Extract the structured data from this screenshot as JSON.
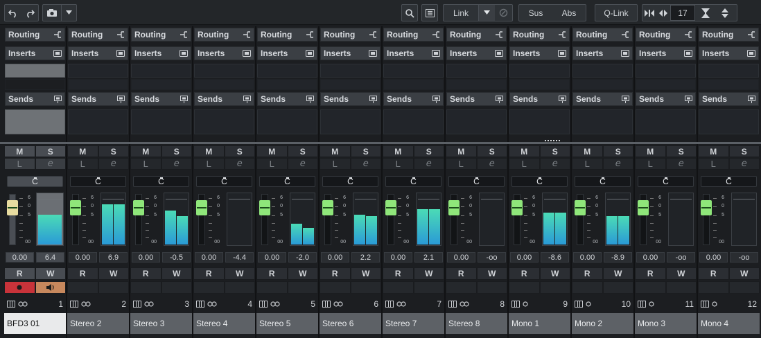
{
  "toolbar": {
    "link_label": "Link",
    "sus_label": "Sus",
    "abs_label": "Abs",
    "qlink_label": "Q-Link",
    "visible_channels": "17"
  },
  "sections": {
    "routing": "Routing",
    "inserts": "Inserts",
    "sends": "Sends"
  },
  "buttons": {
    "mute": "M",
    "solo": "S",
    "listen": "L",
    "edit": "e",
    "read": "R",
    "write": "W"
  },
  "scale_labels": [
    "6",
    "0",
    "5",
    "00"
  ],
  "colors": {
    "meter_top": "#4bdbb6",
    "meter_bottom": "#2a9ad6",
    "record": "#c8333a",
    "monitor": "#c7885d",
    "fader_cap": "#8fe67a",
    "fader_cap_first": "#e8dca0"
  },
  "channels": [
    {
      "number": "1",
      "name": "BFD3 01",
      "volume": "0.00",
      "peak": "6.4",
      "pan": "C",
      "link_icon": "stereo-link-icon",
      "meter": [
        0.58,
        0.58
      ]
    },
    {
      "number": "2",
      "name": "Stereo 2",
      "volume": "0.00",
      "peak": "6.9",
      "pan": "C",
      "link_icon": "stereo-link-icon",
      "meter": [
        0.78,
        0.78
      ]
    },
    {
      "number": "3",
      "name": "Stereo 3",
      "volume": "0.00",
      "peak": "-0.5",
      "pan": "C",
      "link_icon": "stereo-link-icon",
      "meter": [
        0.66,
        0.55
      ]
    },
    {
      "number": "4",
      "name": "Stereo 4",
      "volume": "0.00",
      "peak": "-4.4",
      "pan": "C",
      "link_icon": "stereo-link-icon",
      "meter": [
        0,
        0
      ]
    },
    {
      "number": "5",
      "name": "Stereo 5",
      "volume": "0.00",
      "peak": "-2.0",
      "pan": "C",
      "link_icon": "stereo-link-icon",
      "meter": [
        0.4,
        0.32
      ]
    },
    {
      "number": "6",
      "name": "Stereo 6",
      "volume": "0.00",
      "peak": "2.2",
      "pan": "C",
      "link_icon": "stereo-link-icon",
      "meter": [
        0.58,
        0.55
      ]
    },
    {
      "number": "7",
      "name": "Stereo 7",
      "volume": "0.00",
      "peak": "2.1",
      "pan": "C",
      "link_icon": "stereo-link-icon",
      "meter": [
        0.69,
        0.69
      ]
    },
    {
      "number": "8",
      "name": "Stereo 8",
      "volume": "0.00",
      "peak": "-oo",
      "pan": "C",
      "link_icon": "stereo-link-icon",
      "meter": [
        0,
        0
      ]
    },
    {
      "number": "9",
      "name": "Mono 1",
      "volume": "0.00",
      "peak": "-8.6",
      "pan": "C",
      "link_icon": "mono-icon",
      "meter": [
        0.62,
        0.62
      ]
    },
    {
      "number": "10",
      "name": "Mono 2",
      "volume": "0.00",
      "peak": "-8.9",
      "pan": "C",
      "link_icon": "mono-icon",
      "meter": [
        0.55,
        0.55
      ]
    },
    {
      "number": "11",
      "name": "Mono 3",
      "volume": "0.00",
      "peak": "-oo",
      "pan": "C",
      "link_icon": "mono-icon",
      "meter": [
        0,
        0
      ]
    },
    {
      "number": "12",
      "name": "Mono 4",
      "volume": "0.00",
      "peak": "-oo",
      "pan": "C",
      "link_icon": "mono-icon",
      "meter": [
        0,
        0
      ]
    }
  ]
}
